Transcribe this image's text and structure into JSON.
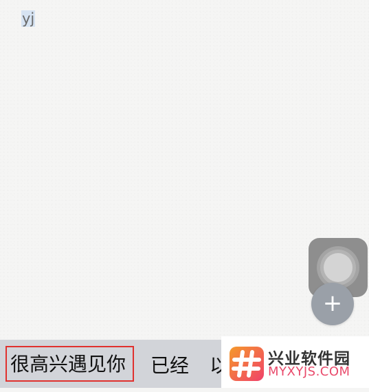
{
  "editor": {
    "typed_text": "yj"
  },
  "overlay": {
    "assistive_touch_icon": "assistive-touch-icon",
    "fab_icon": "plus-icon",
    "fab_symbol": "+"
  },
  "keyboard": {
    "candidates": [
      {
        "text": "很高兴遇见你",
        "highlighted": true
      },
      {
        "text": "已经",
        "highlighted": false
      },
      {
        "text": "以",
        "highlighted": false
      }
    ],
    "highlight_color": "#e0302d"
  },
  "watermark": {
    "title": "兴业软件园",
    "url": "MYXYJS.COM",
    "logo_colors": [
      "#f0406a",
      "#f59a2b"
    ]
  }
}
